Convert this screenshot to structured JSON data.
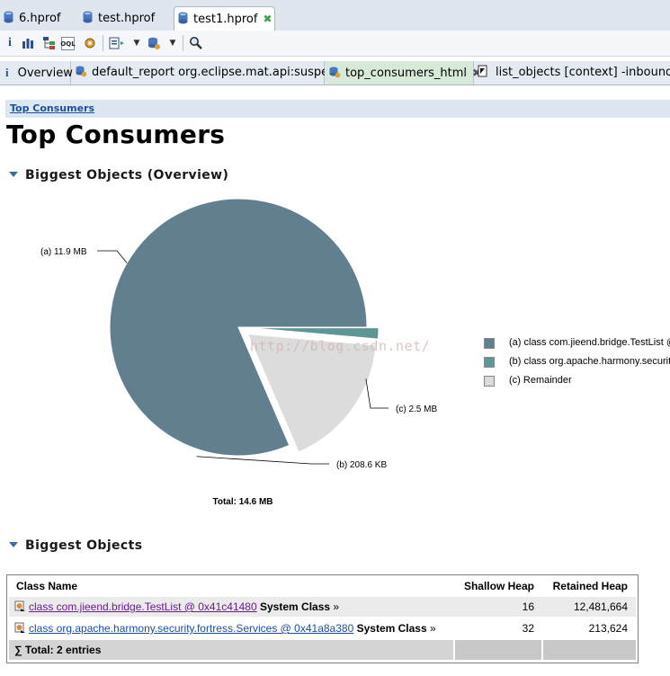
{
  "editor_tabs": [
    {
      "label": "6.hprof"
    },
    {
      "label": "test.hprof"
    },
    {
      "label": "test1.hprof"
    }
  ],
  "view_tabs": [
    {
      "label": "Overview"
    },
    {
      "label": "default_report  org.eclipse.mat.api:suspects"
    },
    {
      "label": "top_consumers_html"
    },
    {
      "label": "list_objects [context] -inbound"
    }
  ],
  "breadcrumb": "Top Consumers",
  "page_title": "Top Consumers",
  "overview_heading": "Biggest Objects (Overview)",
  "chart_data": {
    "type": "pie",
    "total_label": "Total: 14.6 MB",
    "slices": [
      {
        "label": "(a)  11.9 MB",
        "value_mb": 11.9,
        "color": "#627f8f"
      },
      {
        "label": "(b)  208.6 KB",
        "value_mb": 0.2037,
        "color": "#5e9595"
      },
      {
        "label": "(c)  2.5 MB",
        "value_mb": 2.5,
        "color": "#dcdcdc"
      }
    ],
    "legend": [
      {
        "label": "(a)  class com.jieend.bridge.TestList @",
        "color": "#627f8f"
      },
      {
        "label": "(b)  class org.apache.harmony.security",
        "color": "#5e9595"
      },
      {
        "label": "(c)  Remainder",
        "color": "#dcdcdc"
      }
    ],
    "legend_placement": "right"
  },
  "watermark": "http://blog.csdn.net/",
  "objects_heading": "Biggest Objects",
  "table": {
    "columns": [
      "Class Name",
      "Shallow Heap",
      "Retained Heap"
    ],
    "rows": [
      {
        "link": "class com.jieend.bridge.TestList @ 0x41c41480",
        "type": "System Class",
        "arrow": "»",
        "shallow": "16",
        "retained": "12,481,664"
      },
      {
        "link": "class org.apache.harmony.security.fortress.Services @ 0x41a8a380",
        "type": "System Class",
        "arrow": "»",
        "shallow": "32",
        "retained": "213,624"
      }
    ],
    "total": "Total: 2 entries",
    "total_symbol": "∑"
  }
}
